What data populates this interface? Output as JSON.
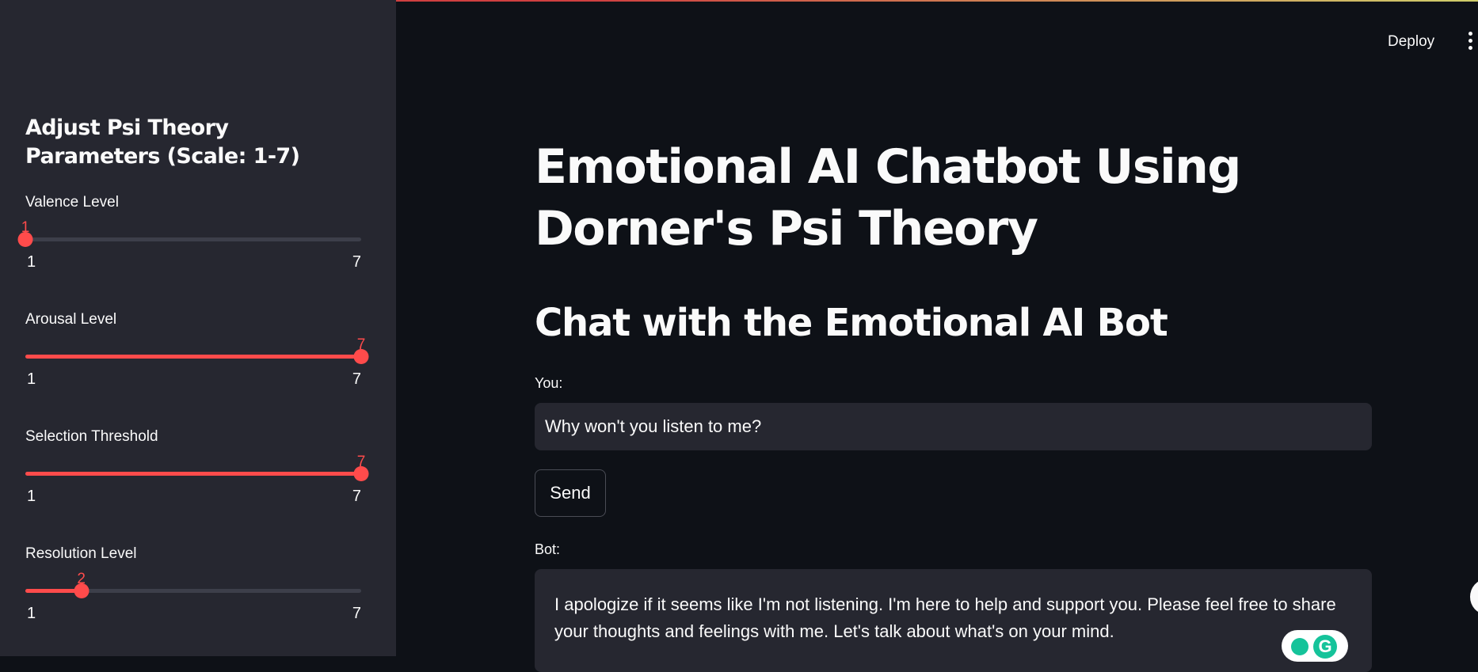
{
  "header": {
    "deploy_label": "Deploy",
    "menu_icon": "more-vertical-icon"
  },
  "sidebar": {
    "title": "Adjust Psi Theory Parameters (Scale: 1-7)",
    "sliders": [
      {
        "label": "Valence Level",
        "value": "1",
        "min": "1",
        "max": "7"
      },
      {
        "label": "Arousal Level",
        "value": "7",
        "min": "1",
        "max": "7"
      },
      {
        "label": "Selection Threshold",
        "value": "7",
        "min": "1",
        "max": "7"
      },
      {
        "label": "Resolution Level",
        "value": "2",
        "min": "1",
        "max": "7"
      }
    ]
  },
  "main": {
    "title": "Emotional AI Chatbot Using Dorner's Psi Theory",
    "subtitle": "Chat with the Emotional AI Bot",
    "you_label": "You:",
    "you_value": "Why won't you listen to me?",
    "send_label": "Send",
    "bot_label": "Bot:",
    "bot_response": "I apologize if it seems like I'm not listening. I'm here to help and support you. Please feel free to share your thoughts and feelings with me. Let's talk about what's on your mind."
  },
  "colors": {
    "accent": "#ff4b4b",
    "background": "#0e1117",
    "sidebar": "#262730"
  }
}
